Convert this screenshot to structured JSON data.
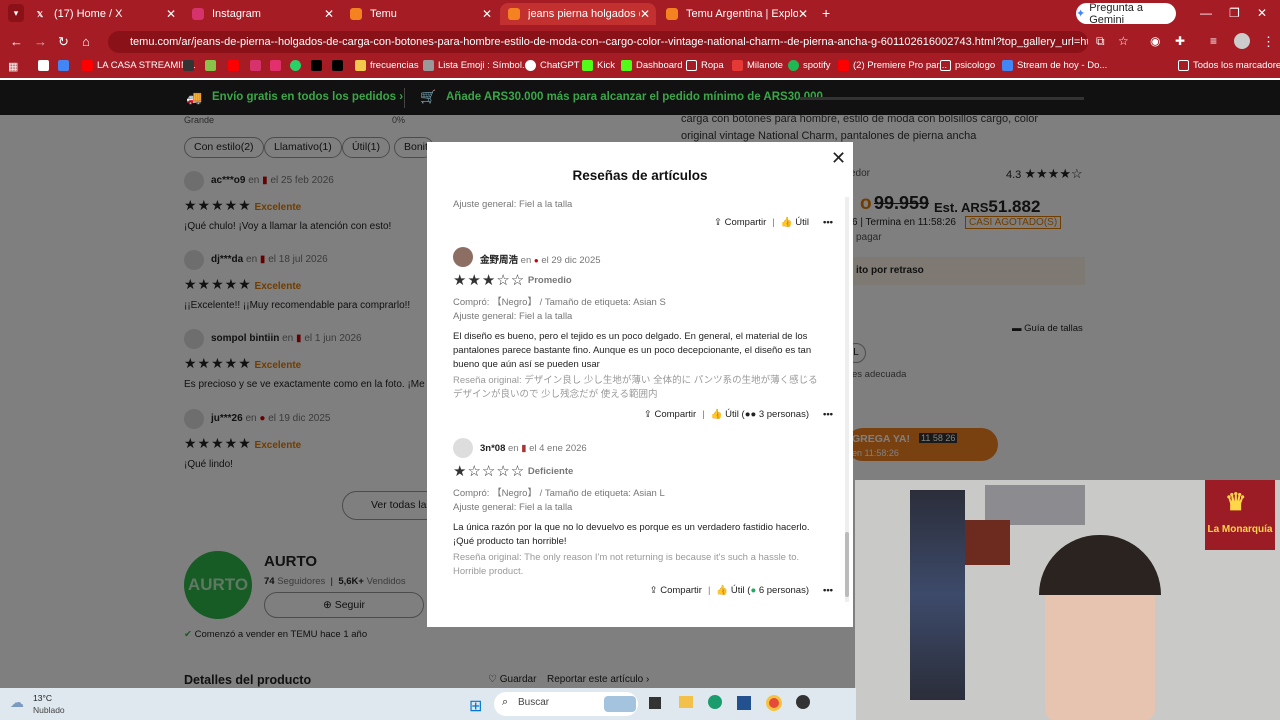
{
  "browser": {
    "tabs": [
      {
        "label": "(17) Home / X",
        "icon": "x-icon"
      },
      {
        "label": "Instagram",
        "icon": "instagram-icon"
      },
      {
        "label": "Temu",
        "icon": "temu-icon"
      },
      {
        "label": "jeans pierna holgados carga bo",
        "icon": "temu-icon"
      },
      {
        "label": "Temu Argentina | Explore the La",
        "icon": "temu-icon"
      }
    ],
    "gemini_label": "Pregunta a Gemini",
    "url": "temu.com/ar/jeans-de-pierna--holgados-de-carga-con-botones-para-hombre-estilo-de-moda-con--cargo-color--vintage-national-charm--de-pierna-ancha-g-601102616002743.html?top_gallery_url=https%3A%2F%2Fimg.kwcdn.c...",
    "bookmarks": [
      "LA CASA STREAMIN...",
      "frecuencias",
      "Lista Emoji : Símbol...",
      "ChatGPT",
      "Kick",
      "Dashboard",
      "Ropa",
      "Milanote",
      "spotify",
      "(2) Premiere Pro par...",
      "psicologo",
      "Stream de hoy - Do..."
    ],
    "bookmarks_all": "Todos los marcadores"
  },
  "promo": {
    "free_shipping": "Envío gratis en todos los pedidos",
    "min_order": "Añade ARS30.000 más para alcanzar el pedido mínimo de ARS30.000"
  },
  "background": {
    "grande_label": "Grande",
    "grande_pct": "0%",
    "filter_chips": [
      "Con estilo(2)",
      "Llamativo(1)",
      "Útil(1)",
      "Bonit"
    ],
    "reviews": [
      {
        "user": "ac***o9",
        "en": "en",
        "date": "el 25 feb 2026",
        "rating_text": "Excelente",
        "text": "¡Qué chulo! ¡Voy a llamar la atención con esto!"
      },
      {
        "user": "dj***da",
        "en": "en",
        "date": "el 18 jul 2026",
        "rating_text": "Excelente",
        "text": "¡¡Excelente!! ¡¡Muy recomendable para comprarlo!!"
      },
      {
        "user": "sompol bintiin",
        "en": "en",
        "date": "el 1 jun 2026",
        "rating_text": "Excelente",
        "text": "Es precioso y se ve exactamente como en la foto. ¡Me enca"
      },
      {
        "user": "ju***26",
        "en": "en",
        "date": "el 19 dic 2025",
        "rating_text": "Excelente",
        "text": "¡Qué lindo!"
      }
    ],
    "see_all": "Ver todas las",
    "store": {
      "logo": "AURTO",
      "name": "AURTO",
      "followers": "74",
      "followers_label": "Seguidores",
      "sold": "5,6K+",
      "sold_label": "Vendidos",
      "follow": "Seguir",
      "since": "Comenzó a vender en TEMU hace 1 año"
    },
    "details": "Detalles del producto",
    "save": "Guardar",
    "report": "Reportar este artículo",
    "product_desc": "carga con botones para hombre, estilo de moda con bolsillos cargo, color original vintage National Charm, pantalones de pierna ancha",
    "seller_tail": "edor",
    "rating_value": "4.3",
    "old_price": "99.959",
    "price_prefix": "Est. ARS",
    "price": "51.882",
    "timer": "6 | Termina en 11:58:26",
    "sold_out": "CASI AGOTADO(S)",
    "pay_tail": "pagar",
    "pickup": "ito por retraso",
    "size_guide": "Guía de tallas",
    "size_l": "L",
    "fit_tail": "es adecuada",
    "cta": "GREGA YA!",
    "cta_timer": "11 58 26",
    "cta_sub": "en 11:58:26"
  },
  "modal": {
    "title": "Reseñas de artículos",
    "top_fit": "Ajuste general: Fiel a la talla",
    "share": "Compartir",
    "useful": "Útil",
    "reviews": [
      {
        "user": "金野周浩",
        "en": "en",
        "date": "el 29 dic 2025",
        "rating_label": "Promedio",
        "stars": 3,
        "bought": "Compró: 【Negro】 / Tamaño de etiqueta: Asian S",
        "fit": "Ajuste general: Fiel a la talla",
        "text": "El diseño es bueno, pero el tejido es un poco delgado. En general, el material de los pantalones parece bastante fino. Aunque es un poco decepcionante, el diseño es tan bueno que aún así se pueden usar",
        "original": "Reseña original: デザイン良し 少し生地が薄い 全体的に パンツ系の生地が薄く感じる デザインが良いので 少し残念だが 使える範囲内",
        "useful_count": "3 personas"
      },
      {
        "user": "3n*08",
        "en": "en",
        "date": "el 4 ene 2026",
        "rating_label": "Deficiente",
        "stars": 1,
        "bought": "Compró: 【Negro】 / Tamaño de etiqueta: Asian L",
        "fit": "Ajuste general: Fiel a la talla",
        "text": "La única razón por la que no lo devuelvo es porque es un verdadero fastidio hacerlo. ¡Qué producto tan horrible!",
        "original": "Reseña original: The only reason I'm not returning is because it's such a hassle to. Horrible product.",
        "useful_count": "6 personas"
      }
    ]
  },
  "webcam": {
    "badge": "La Monarquía"
  },
  "taskbar": {
    "temp": "13°C",
    "weather": "Nublado",
    "search": "Buscar"
  }
}
